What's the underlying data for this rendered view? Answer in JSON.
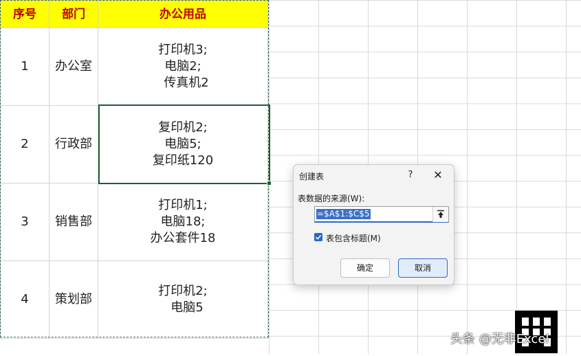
{
  "sheet": {
    "headers": [
      "序号",
      "部门",
      "办公用品"
    ],
    "rows": [
      {
        "no": "1",
        "dept": "办公室",
        "items": [
          "打印机3;",
          "电脑2;",
          "传真机2"
        ]
      },
      {
        "no": "2",
        "dept": "行政部",
        "items": [
          "复印机2;",
          "电脑5;",
          "复印纸120"
        ]
      },
      {
        "no": "3",
        "dept": "销售部",
        "items": [
          "打印机1;",
          "电脑18;",
          "办公套件18"
        ]
      },
      {
        "no": "4",
        "dept": "策划部",
        "items": [
          "打印机2;",
          "电脑5"
        ]
      }
    ],
    "header_bg": "#ffff00",
    "header_color": "#c00000"
  },
  "dialog": {
    "title": "创建表",
    "help": "?",
    "close": "✕",
    "source_label": "表数据的来源(W):",
    "range": "=$A$1:$C$5",
    "has_headers_label": "表包含标题(M)",
    "has_headers_checked": true,
    "ok_label": "确定",
    "cancel_label": "取消",
    "accent": "#2b68c8"
  },
  "watermark": {
    "text": "头条 @无非Excel"
  },
  "icons": {
    "collapse": "collapse-arrow-icon",
    "check": "checkmark-icon",
    "close": "close-icon",
    "help": "help-icon"
  }
}
